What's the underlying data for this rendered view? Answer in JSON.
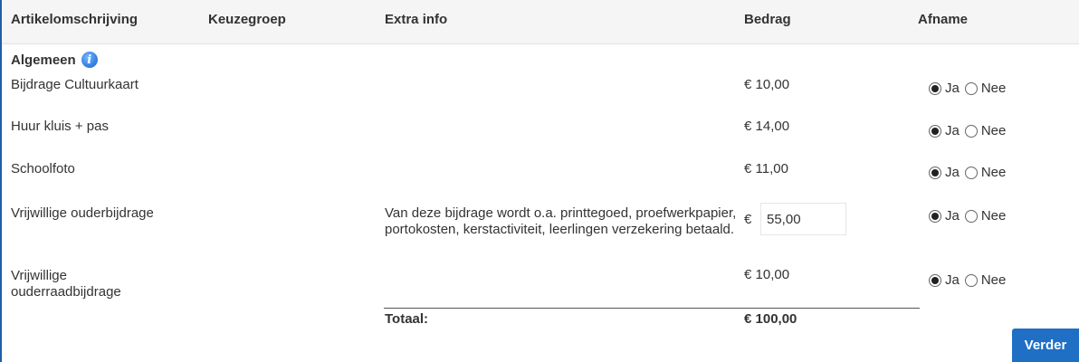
{
  "headers": {
    "col1": "Artikelomschrijving",
    "col2": "Keuzegroep",
    "col3": "Extra info",
    "col4": "Bedrag",
    "col5": "Afname"
  },
  "section": {
    "title": "Algemeen",
    "info_icon": "info-icon"
  },
  "rows": [
    {
      "desc": "Bijdrage Cultuurkaart",
      "extra": "",
      "amount": "€ 10,00",
      "afname": "Ja"
    },
    {
      "desc": "Huur kluis + pas",
      "extra": "",
      "amount": "€ 14,00",
      "afname": "Ja"
    },
    {
      "desc": "Schoolfoto",
      "extra": "",
      "amount": "€ 11,00",
      "afname": "Ja"
    },
    {
      "desc": "Vrijwillige ouderbijdrage",
      "extra": "Van deze bijdrage wordt o.a. printtegoed, proefwerkpapier, portokosten, kerstactiviteit, leerlingen verzekering betaald.",
      "currency": "€",
      "input_value": "55,00",
      "afname": "Ja"
    },
    {
      "desc_line1": "Vrijwillige",
      "desc_line2": "ouderraadbijdrage",
      "extra": "",
      "amount": "€ 10,00",
      "afname": "Ja"
    }
  ],
  "radio": {
    "yes": "Ja",
    "no": "Nee"
  },
  "total": {
    "label": "Totaal:",
    "amount": "€ 100,00"
  },
  "button": {
    "verder": "Verder"
  },
  "colors": {
    "accent": "#1f6fc4",
    "info": "#3a87e6"
  }
}
